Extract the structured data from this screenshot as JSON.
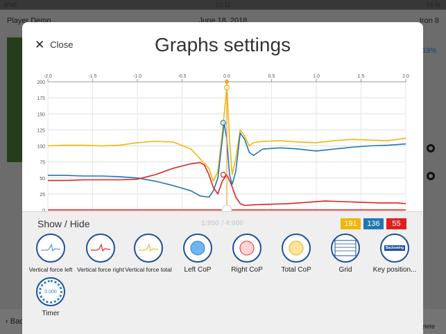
{
  "status_bar": {
    "device": "iPad",
    "time": "10:11",
    "battery": "74 %"
  },
  "background": {
    "header_left": "Player Demo",
    "header_center": "June 18, 2018",
    "header_right": "Iron 8",
    "percent": "19%",
    "back_label": "Back",
    "delete_label": "Delete"
  },
  "modal": {
    "close_label": "Close",
    "title": "Graphs settings",
    "time_current": "1:950",
    "time_total": "/ 4:000",
    "badges": [
      {
        "value": "191",
        "color": "#f2b705"
      },
      {
        "value": "136",
        "color": "#1f77b4"
      },
      {
        "value": "55",
        "color": "#e02020"
      }
    ],
    "show_hide_label": "Show / Hide",
    "options": [
      {
        "label": "Vertical force left",
        "icon": "vertical-force-left-icon"
      },
      {
        "label": "Vertical force right",
        "icon": "vertical-force-right-icon"
      },
      {
        "label": "Vertical force total",
        "icon": "vertical-force-total-icon"
      },
      {
        "label": "Left CoP",
        "icon": "left-cop-icon"
      },
      {
        "label": "Right CoP",
        "icon": "right-cop-icon"
      },
      {
        "label": "Total CoP",
        "icon": "total-cop-icon"
      },
      {
        "label": "Grid",
        "icon": "grid-icon"
      },
      {
        "label": "Key position...",
        "icon": "key-position-icon",
        "icon_text": "Backswing"
      },
      {
        "label": "Timer",
        "icon": "timer-icon",
        "icon_text": "0.000"
      }
    ]
  },
  "chart_data": {
    "type": "line",
    "x_ticks": [
      "-2.0",
      "-1.5",
      "-1.0",
      "-0.5",
      "0.0",
      "0.5",
      "1.0",
      "1.5",
      "2.0"
    ],
    "y_ticks": [
      "0",
      "25",
      "50",
      "75",
      "100",
      "125",
      "150",
      "175",
      "200"
    ],
    "xlim": [
      -2.0,
      2.0
    ],
    "ylim": [
      0,
      200
    ],
    "grid": true,
    "series": [
      {
        "color": "#f2b705",
        "x": [
          -2.0,
          -1.8,
          -1.6,
          -1.4,
          -1.2,
          -1.0,
          -0.8,
          -0.6,
          -0.4,
          -0.3,
          -0.2,
          -0.15,
          -0.1,
          -0.05,
          0.0,
          0.03,
          0.06,
          0.1,
          0.15,
          0.2,
          0.25,
          0.3,
          0.4,
          0.6,
          0.8,
          1.0,
          1.2,
          1.4,
          1.6,
          1.8,
          2.0
        ],
        "values": [
          100,
          101,
          101,
          100,
          101,
          105,
          107,
          106,
          95,
          80,
          65,
          45,
          60,
          120,
          191,
          110,
          55,
          80,
          125,
          115,
          100,
          105,
          107,
          108,
          106,
          105,
          108,
          110,
          109,
          108,
          112
        ]
      },
      {
        "color": "#1f77b4",
        "x": [
          -2.0,
          -1.8,
          -1.6,
          -1.4,
          -1.2,
          -1.0,
          -0.8,
          -0.6,
          -0.4,
          -0.3,
          -0.2,
          -0.15,
          -0.1,
          -0.05,
          -0.03,
          0.0,
          0.03,
          0.06,
          0.1,
          0.15,
          0.2,
          0.25,
          0.3,
          0.4,
          0.6,
          0.8,
          1.0,
          1.2,
          1.4,
          1.6,
          1.8,
          2.0
        ],
        "values": [
          54,
          54,
          53,
          53,
          52,
          50,
          45,
          38,
          30,
          22,
          20,
          30,
          50,
          110,
          136,
          110,
          55,
          40,
          60,
          120,
          110,
          90,
          85,
          95,
          97,
          95,
          92,
          95,
          98,
          100,
          101,
          103
        ]
      },
      {
        "color": "#e02020",
        "x": [
          -2.0,
          -1.8,
          -1.6,
          -1.4,
          -1.2,
          -1.0,
          -0.8,
          -0.6,
          -0.4,
          -0.3,
          -0.25,
          -0.2,
          -0.15,
          -0.1,
          -0.05,
          0.0,
          0.05,
          0.1,
          0.15,
          0.2,
          0.3,
          0.5,
          0.7,
          0.9,
          1.1,
          1.3,
          1.5,
          1.7,
          1.9,
          2.0
        ],
        "values": [
          46,
          46,
          47,
          47,
          47,
          48,
          55,
          65,
          72,
          74,
          70,
          55,
          35,
          25,
          45,
          55,
          40,
          20,
          10,
          7,
          8,
          9,
          10,
          12,
          14,
          13,
          12,
          11,
          11,
          10
        ]
      },
      {
        "color": "#d01010",
        "x": [
          -2.0,
          2.0
        ],
        "values": [
          0,
          0
        ]
      }
    ],
    "markers": [
      {
        "x": 0.0,
        "y": 191,
        "color": "#f2b705"
      },
      {
        "x": -0.04,
        "y": 136,
        "color": "#1f77b4"
      },
      {
        "x": -0.04,
        "y": 55,
        "color": "#e02020"
      }
    ],
    "cursor_x": 0.0,
    "playhead_x": 0.0
  }
}
